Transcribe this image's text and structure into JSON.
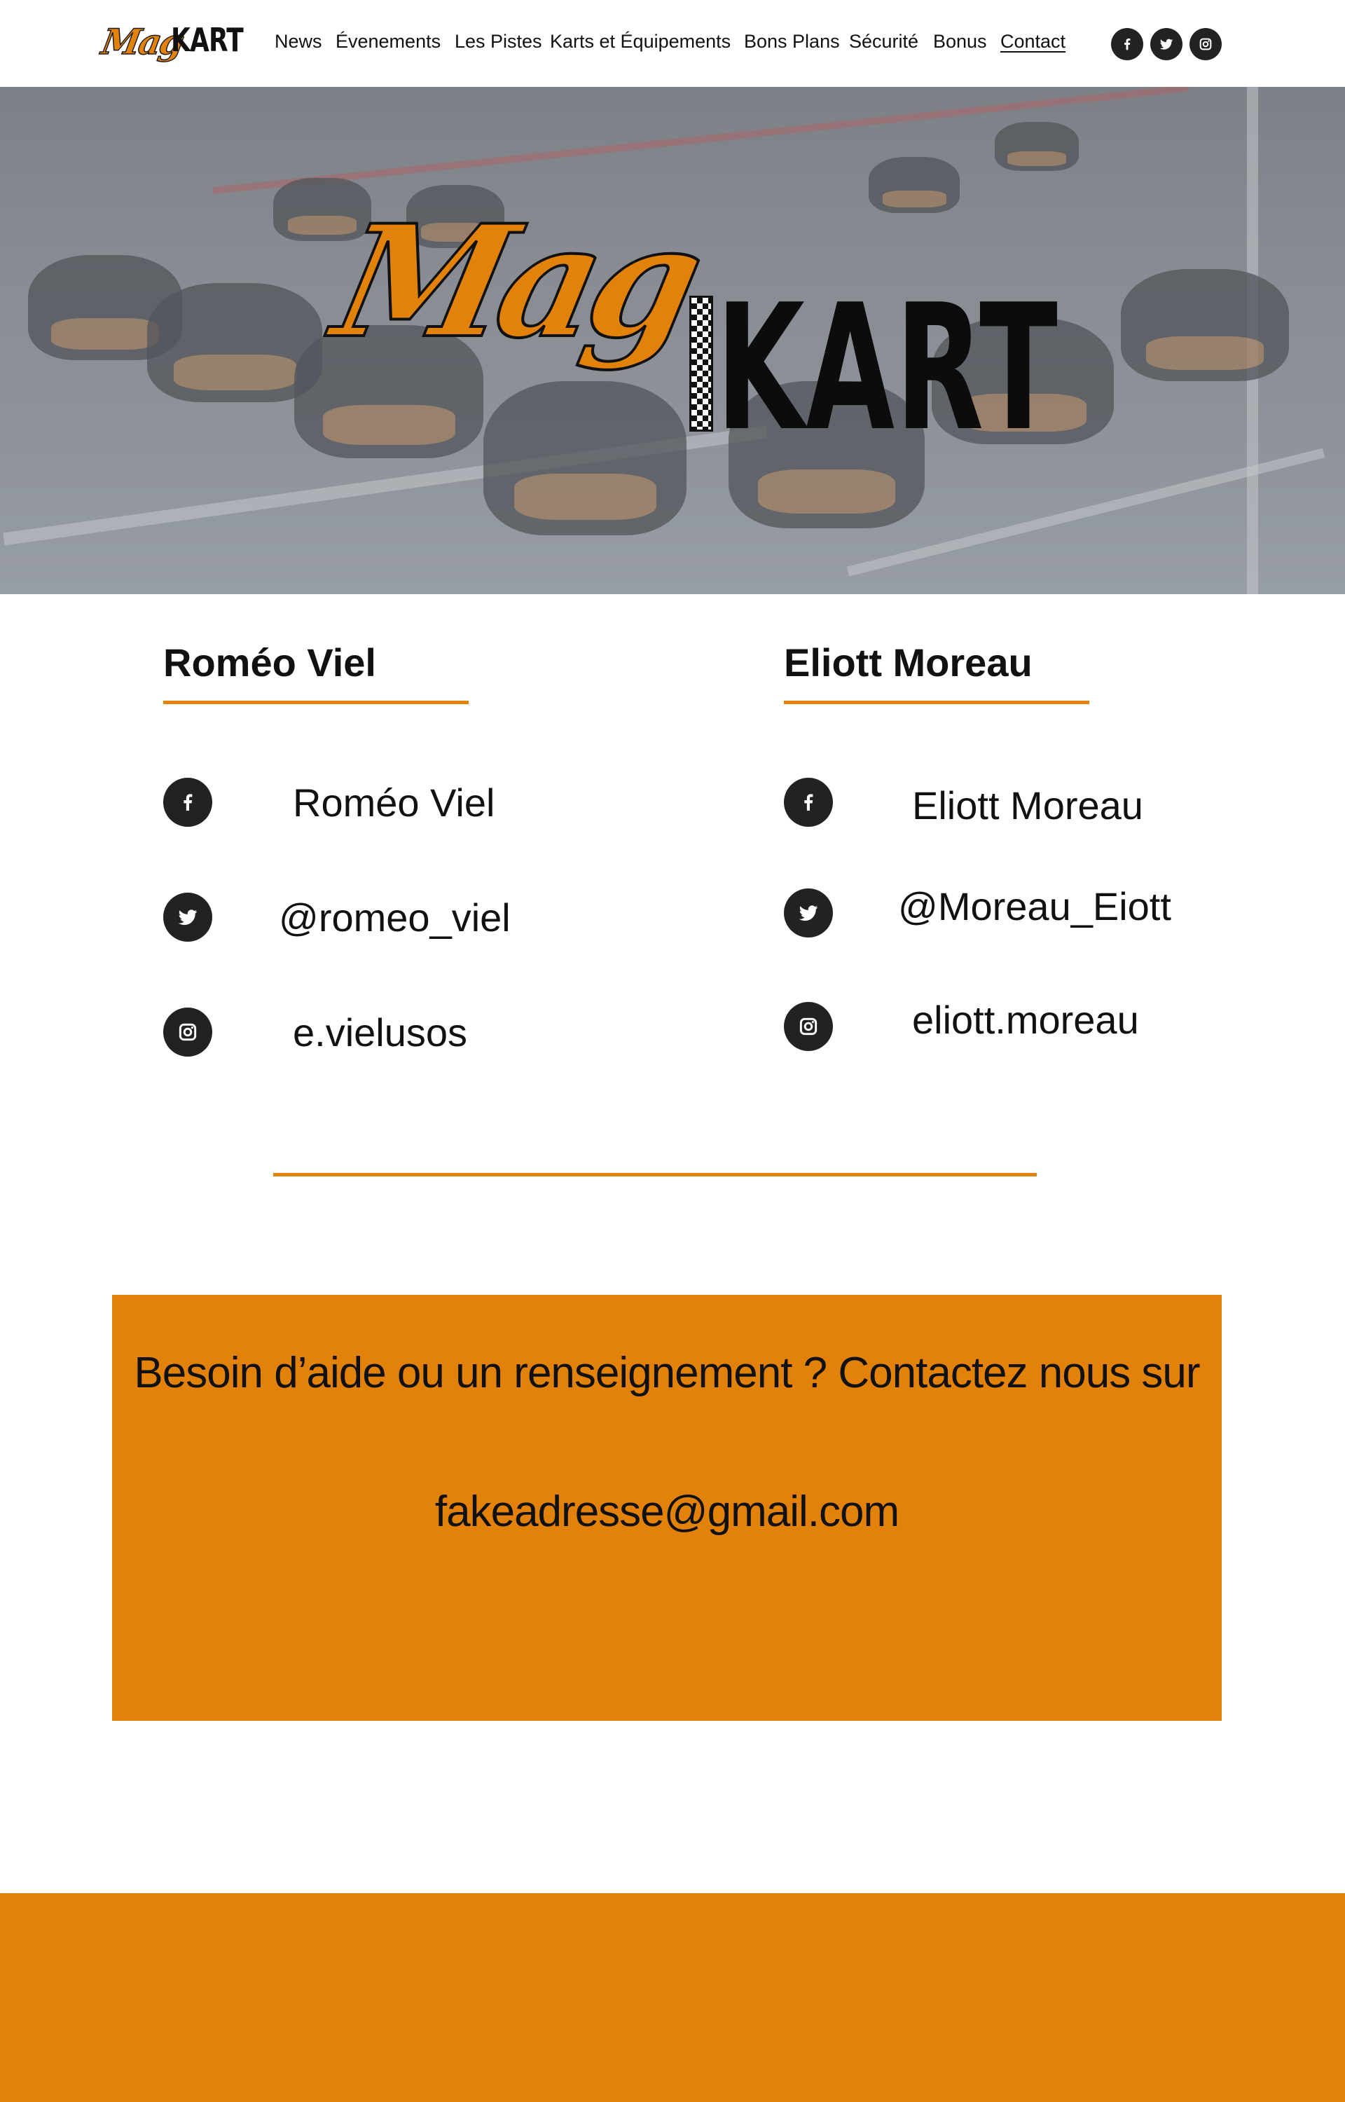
{
  "brand": {
    "mag": "Mag",
    "kart": "KART"
  },
  "nav": {
    "items": [
      {
        "label": "News"
      },
      {
        "label": "Évenements"
      },
      {
        "label": "Les Pistes"
      },
      {
        "label": "Karts et Équipements"
      },
      {
        "label": "Bons Plans"
      },
      {
        "label": "Sécurité"
      },
      {
        "label": "Bonus"
      },
      {
        "label": "Contact"
      }
    ],
    "active": "Contact",
    "social_icons": [
      "facebook-icon",
      "twitter-icon",
      "instagram-icon"
    ]
  },
  "hero": {
    "logo_mag": "Mag",
    "logo_kart": "KART"
  },
  "contacts": [
    {
      "name": "Roméo Viel",
      "facebook": "Roméo Viel",
      "twitter": "@romeo_viel",
      "instagram": "e.vielusos"
    },
    {
      "name": "Eliott Moreau",
      "facebook": "Eliott Moreau",
      "twitter": "@Moreau_Eiott",
      "instagram": "eliott.moreau"
    }
  ],
  "help": {
    "text": "Besoin d’aide ou un renseignement ? Contactez nous sur",
    "email": "fakeadresse@gmail.com"
  },
  "colors": {
    "accent": "#e3820b",
    "dark": "#222222",
    "text": "#111111",
    "background": "#ffffff"
  }
}
